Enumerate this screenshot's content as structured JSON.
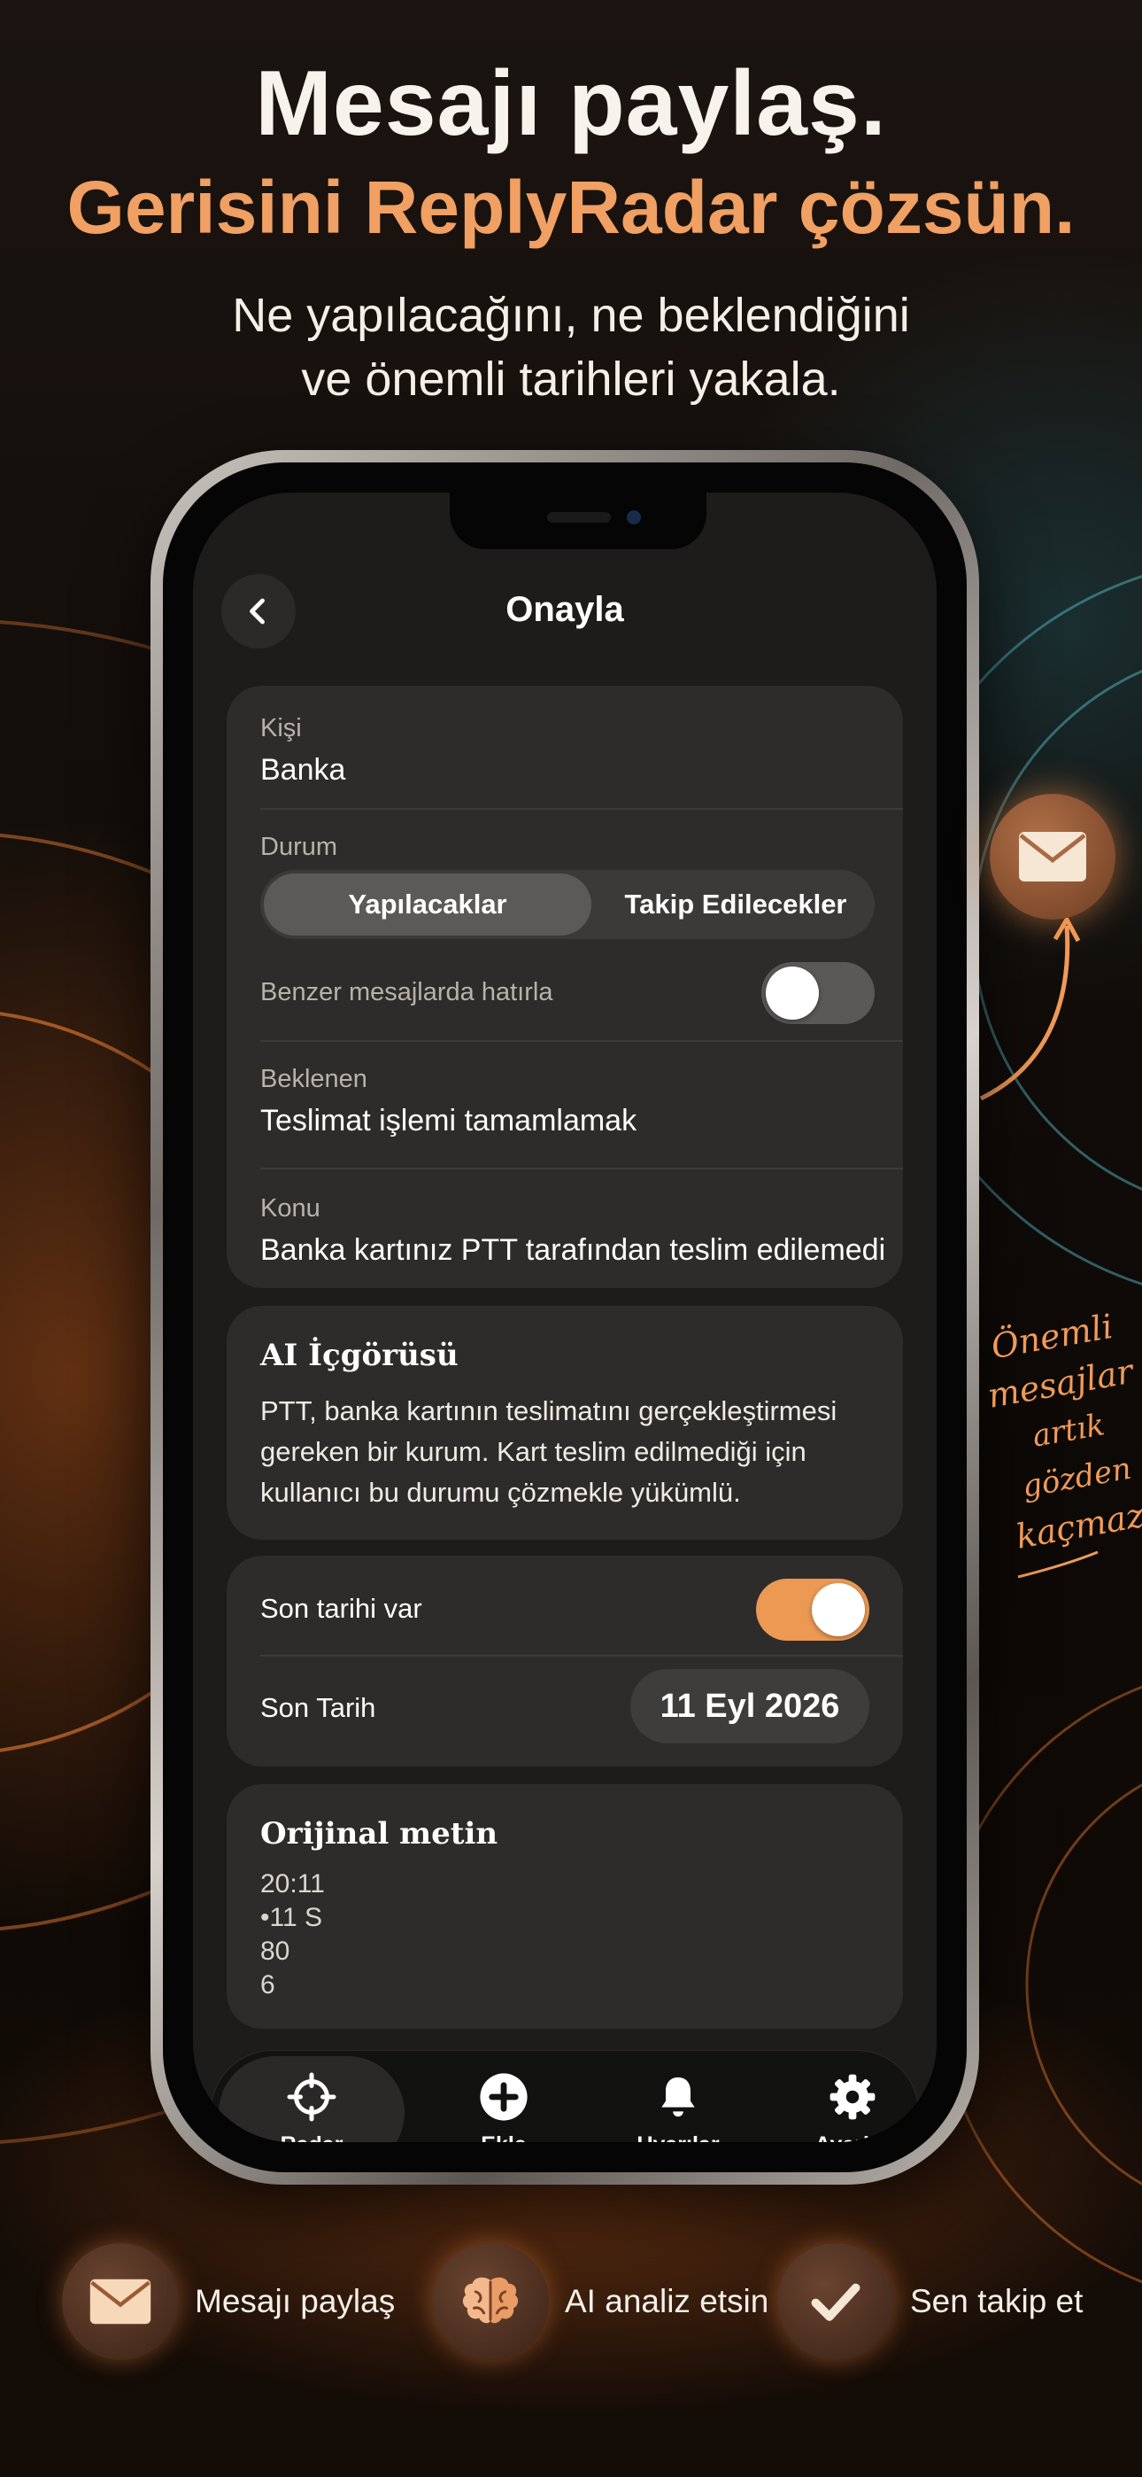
{
  "headline": {
    "line1": "Mesajı paylaş.",
    "line2": "Gerisini ReplyRadar çözsün.",
    "subtitle1": "Ne yapılacağını, ne beklendiğini",
    "subtitle2": "ve önemli tarihleri yakala."
  },
  "screen": {
    "title": "Onayla",
    "person": {
      "label": "Kişi",
      "value": "Banka"
    },
    "status": {
      "label": "Durum",
      "options": [
        "Yapılacaklar",
        "Takip Edilecekler"
      ],
      "selected": "Yapılacaklar"
    },
    "remember": {
      "label": "Benzer mesajlarda hatırla",
      "on": false
    },
    "expected": {
      "label": "Beklenen",
      "value": "Teslimat işlemi tamamlamak"
    },
    "subject": {
      "label": "Konu",
      "value": "Banka kartınız PTT tarafından teslim edilemedi"
    },
    "ai_insight": {
      "title": "AI İçgörüsü",
      "lines": [
        "PTT, banka kartının teslimatını gerçekleştirmesi",
        "gereken bir kurum. Kart teslim edilmediği için",
        "kullanıcı bu durumu çözmekle yükümlü."
      ]
    },
    "deadline": {
      "has_label": "Son tarihi var",
      "has_deadline": true,
      "date_label": "Son Tarih",
      "date_value": "11 Eyl 2026"
    },
    "original": {
      "title": "Orijinal metin",
      "lines": [
        "20:11",
        "•11 S",
        "80",
        "6"
      ]
    },
    "tabs": [
      {
        "label": "Radar",
        "icon": "crosshair-icon",
        "active": true
      },
      {
        "label": "Ekle",
        "icon": "plus-circle-icon",
        "active": false
      },
      {
        "label": "Uyarılar",
        "icon": "bell-icon",
        "active": false
      },
      {
        "label": "Ayarlar",
        "icon": "gear-icon",
        "active": false
      }
    ]
  },
  "side_note": {
    "lines": [
      "Önemli",
      "mesajlar",
      "artık gözden",
      "kaçmaz."
    ]
  },
  "features": [
    {
      "label": "Mesajı paylaş",
      "icon": "envelope-icon"
    },
    {
      "label": "AI analiz etsin",
      "icon": "brain-icon"
    },
    {
      "label": "Sen takip et",
      "icon": "checkmark-icon"
    }
  ],
  "colors": {
    "accent": "#eb9953",
    "headline_accent": "#f0a062",
    "background": "#120c08",
    "card": "#2d2c2b"
  }
}
